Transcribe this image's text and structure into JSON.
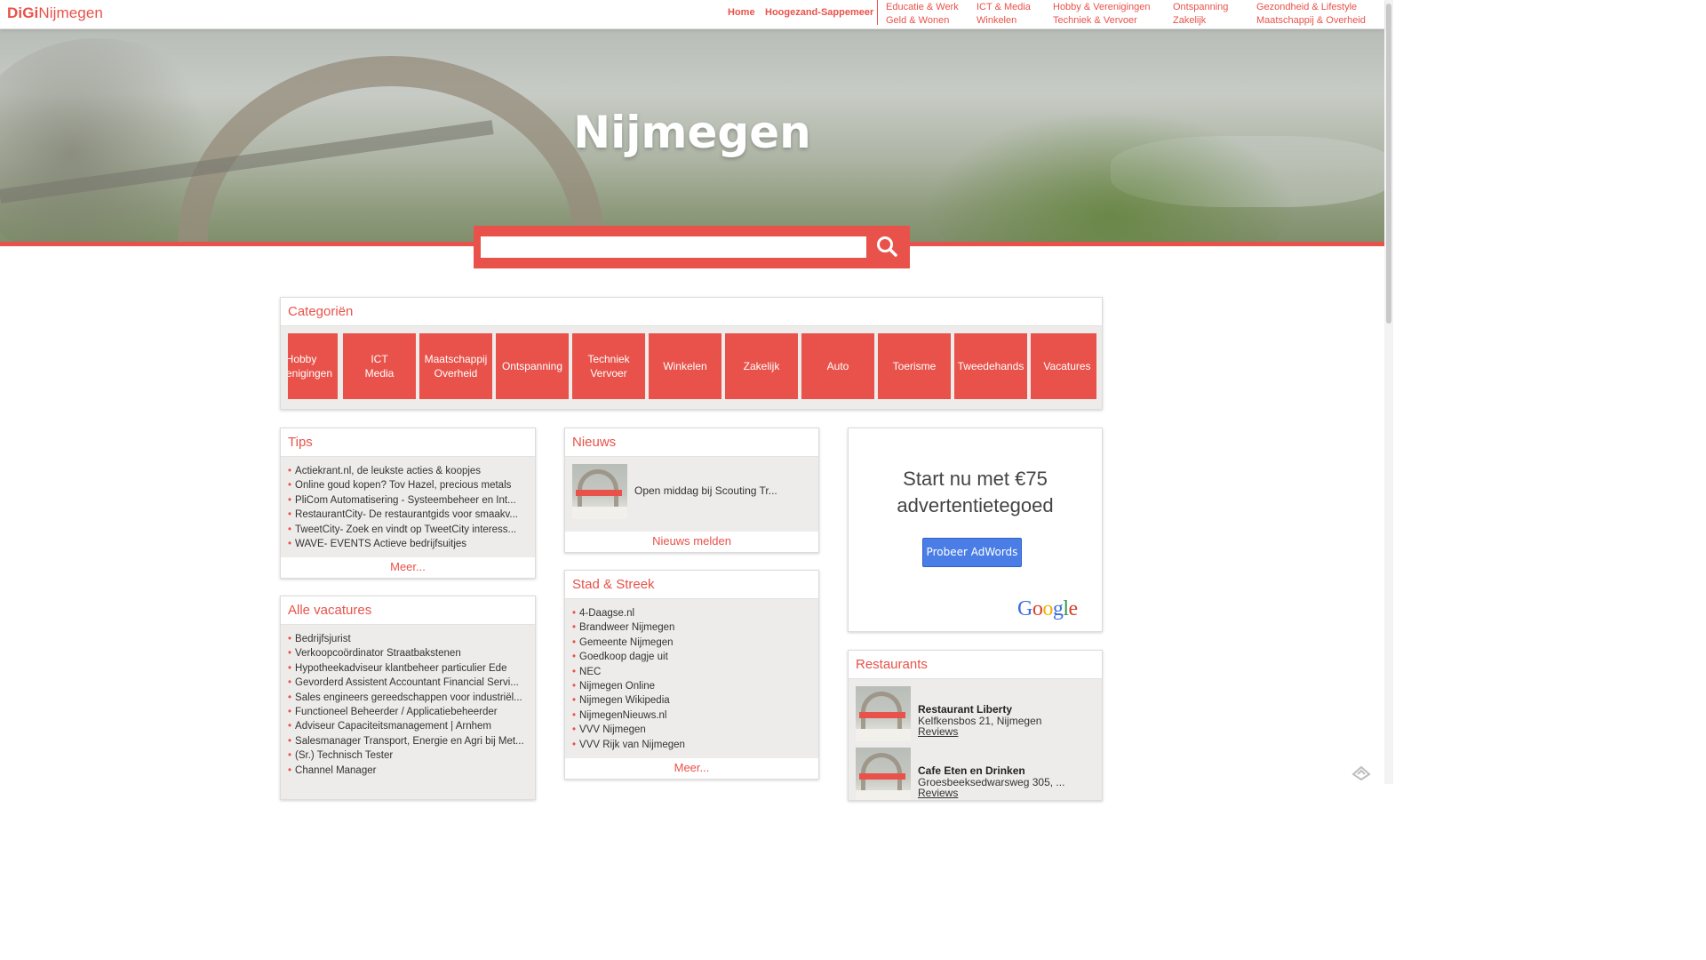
{
  "site": {
    "logo_bold": "DiGi",
    "logo_rest": "Nijmegen"
  },
  "nav": {
    "home": "Home",
    "city": "Hoogezand-Sappemeer",
    "columns": [
      [
        "Educatie & Werk",
        "Geld & Wonen"
      ],
      [
        "ICT & Media",
        "Winkelen"
      ],
      [
        "Hobby & Verenigingen",
        "Techniek & Vervoer"
      ],
      [
        "Ontspanning",
        "Zakelijk"
      ],
      [
        "Gezondheid & Lifestyle",
        "Maatschappij & Overheid"
      ]
    ]
  },
  "hero": {
    "title": "Nijmegen"
  },
  "search": {
    "value": "",
    "button_icon": "search-icon"
  },
  "categories": {
    "title": "Categoriën",
    "items": [
      {
        "line1": "Hobby",
        "line2": "Verenigingen"
      },
      {
        "line1": "ICT",
        "line2": "Media"
      },
      {
        "line1": "Maatschappij",
        "line2": "Overheid"
      },
      {
        "line1": "Ontspanning",
        "line2": ""
      },
      {
        "line1": "Techniek",
        "line2": "Vervoer"
      },
      {
        "line1": "Winkelen",
        "line2": ""
      },
      {
        "line1": "Zakelijk",
        "line2": ""
      },
      {
        "line1": "Auto",
        "line2": ""
      },
      {
        "line1": "Toerisme",
        "line2": ""
      },
      {
        "line1": "Tweedehands",
        "line2": ""
      },
      {
        "line1": "Vacatures",
        "line2": ""
      }
    ]
  },
  "tips": {
    "title": "Tips",
    "items": [
      "Actiekrant.nl, de leukste acties & koopjes",
      "Online goud kopen? Tov Hazel, precious metals",
      "PliCom Automatisering - Systeembeheer en Int...",
      "RestaurantCity- De restaurantgids voor smaakv...",
      "TweetCity- Zoek en vindt op TweetCity interess...",
      "WAVE- EVENTS Actieve bedrijfsuitjes"
    ],
    "more": "Meer..."
  },
  "vacatures": {
    "title": "Alle vacatures",
    "items": [
      "Bedrijfsjurist",
      "Verkoopcoördinator Straatbakstenen",
      "Hypotheekadviseur klantbeheer particulier Ede",
      "Gevorderd Assistent Accountant Financial Servi...",
      "Sales engineers gereedschappen voor industriël...",
      "Functioneel Beheerder / Applicatiebeheerder",
      "Adviseur Capaciteitsmanagement | Arnhem",
      "Salesmanager Transport, Energie en Agri bij Met...",
      "(Sr.) Technisch Tester",
      "Channel Manager"
    ]
  },
  "nieuws": {
    "title": "Nieuws",
    "item": "Open middag bij Scouting Tr...",
    "report": "Nieuws melden"
  },
  "stad": {
    "title": "Stad & Streek",
    "items": [
      "4-Daagse.nl",
      "Brandweer Nijmegen",
      "Gemeente Nijmegen",
      "Goedkoop dagje uit",
      "NEC",
      "Nijmegen Online",
      "Nijmegen Wikipedia",
      "NijmegenNieuws.nl",
      "VVV Nijmegen",
      "VVV Rijk van Nijmegen"
    ],
    "more": "Meer..."
  },
  "ad": {
    "line1": "Start nu met €75",
    "line2": "advertentietegoed",
    "button": "Probeer AdWords",
    "brand": "Google"
  },
  "restaurants": {
    "title": "Restaurants",
    "items": [
      {
        "name": "Restaurant Liberty",
        "address": "Kelfkensbos 21, Nijmegen",
        "link": "Reviews"
      },
      {
        "name": "Cafe Eten en Drinken",
        "address": "Groesbeeksedwarsweg 305, ...",
        "link": "Reviews"
      }
    ]
  },
  "colors": {
    "accent": "#e8524a",
    "adwords": "#4a7ee6",
    "panel_bg": "#edecea"
  }
}
